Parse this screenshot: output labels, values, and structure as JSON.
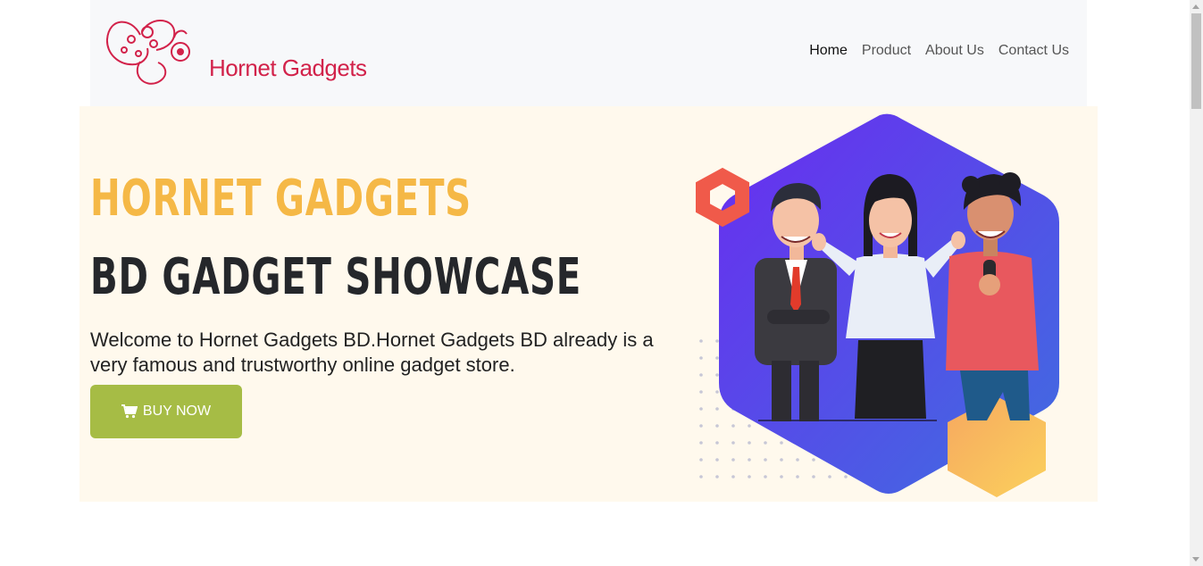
{
  "brand": {
    "name": "Hornet Gadgets",
    "color": "#d2224a"
  },
  "nav": {
    "items": [
      {
        "label": "Home",
        "active": true
      },
      {
        "label": "Product",
        "active": false
      },
      {
        "label": "About Us",
        "active": false
      },
      {
        "label": "Contact Us",
        "active": false
      }
    ]
  },
  "hero": {
    "title": "HORNET GADGETS",
    "subtitle": "BD GADGET SHOWCASE",
    "description": "Welcome to Hornet Gadgets BD.Hornet Gadgets BD already is a very famous and trustworthy online gadget store.",
    "button_label": "BUY NOW",
    "button_icon": "cart-icon",
    "colors": {
      "title": "#f5b846",
      "subtitle": "#25272b",
      "button": "#a6bc45",
      "background": "#fff9ed"
    }
  }
}
